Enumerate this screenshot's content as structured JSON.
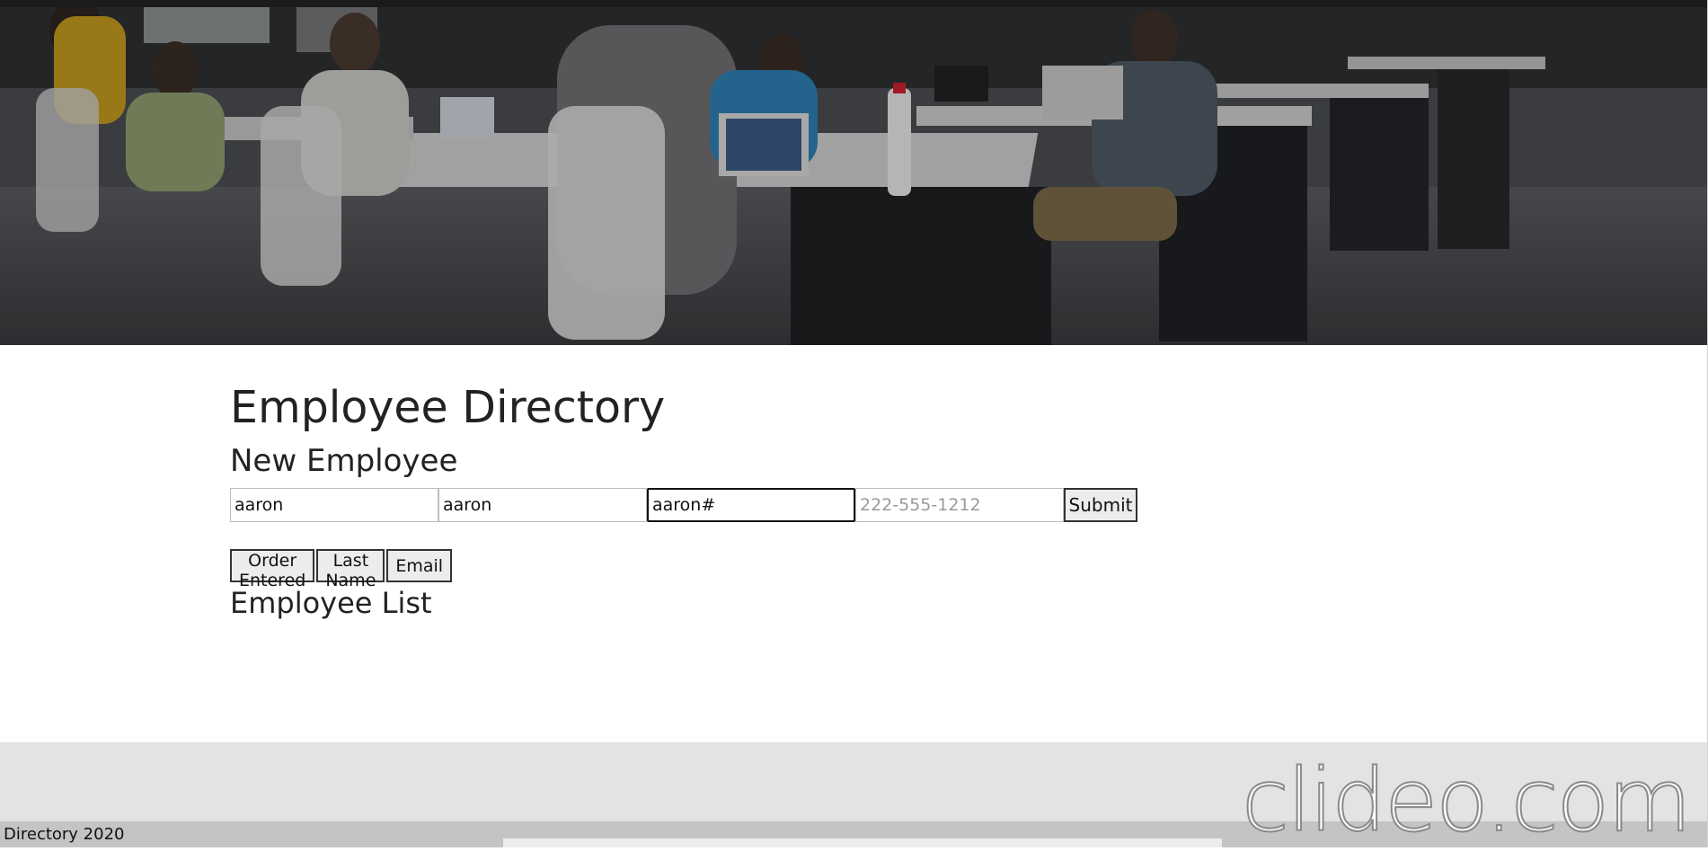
{
  "page": {
    "title": "Employee Directory",
    "subtitle": "New Employee",
    "list_title": "Employee List"
  },
  "form": {
    "first_name_value": "aaron",
    "last_name_value": "aaron",
    "email_value": "aaron#",
    "phone_placeholder": "222-555-1212",
    "submit_label": "Submit"
  },
  "sort": {
    "order_entered_label": "Order Entered",
    "last_name_label": "Last Name",
    "email_label": "Email"
  },
  "footer": {
    "text": "Directory 2020"
  },
  "watermark": {
    "text": "clideo.com"
  },
  "colors": {
    "footer_band": "#e3e3e3",
    "footer_bar": "#c4c4c4",
    "text": "#212529"
  }
}
